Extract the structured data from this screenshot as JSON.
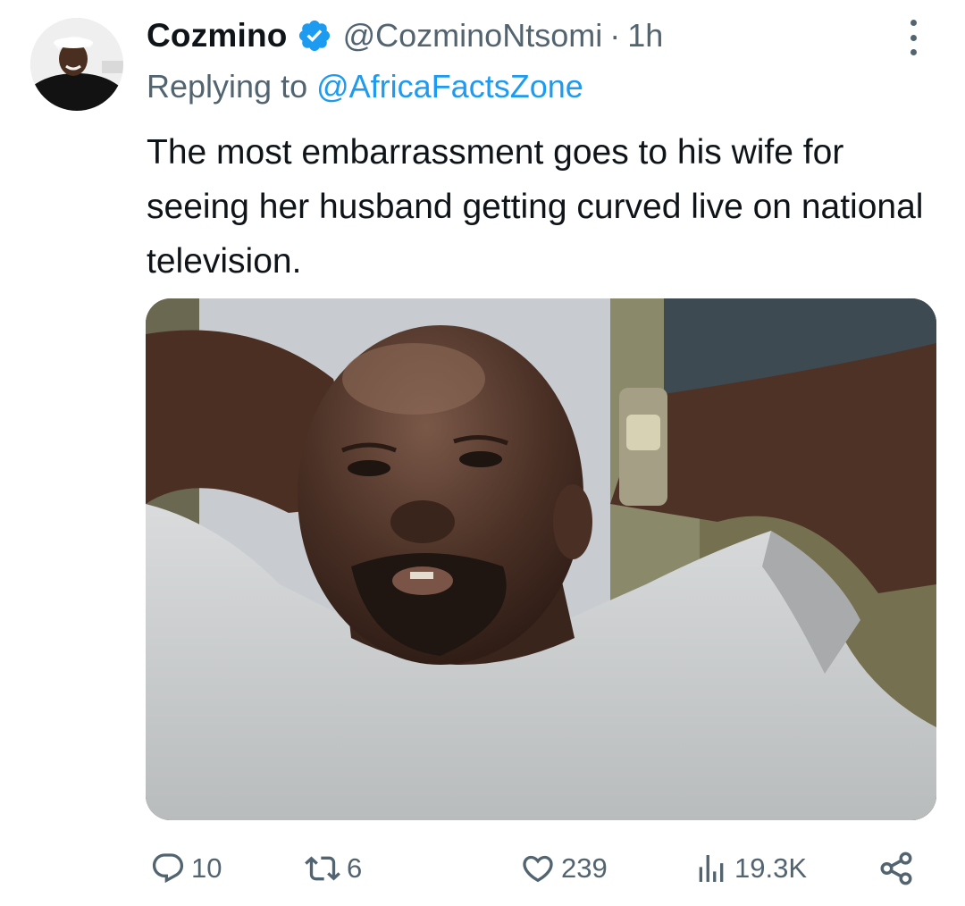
{
  "tweet": {
    "author": {
      "display_name": "Cozmino",
      "handle": "@CozminoNtsomi",
      "verified": true,
      "avatar": "avatar-photo"
    },
    "separator": "·",
    "time": "1h",
    "reply_prefix": "Replying to",
    "reply_to": "@AfricaFactsZone",
    "text": "The most embarrassment goes to his wife for seeing her husband getting curved live on national television.",
    "media": {
      "kind": "photo"
    },
    "actions": {
      "replies": "10",
      "retweets": "6",
      "likes": "239",
      "views": "19.3K"
    }
  },
  "icons": {
    "verified": "verified-badge-icon",
    "more": "more-options-icon",
    "reply": "reply-icon",
    "retweet": "retweet-icon",
    "like": "heart-icon",
    "views": "views-chart-icon",
    "share": "share-icon"
  },
  "colors": {
    "accent": "#1d9bf0",
    "text_primary": "#0f1419",
    "text_secondary": "#536471"
  }
}
